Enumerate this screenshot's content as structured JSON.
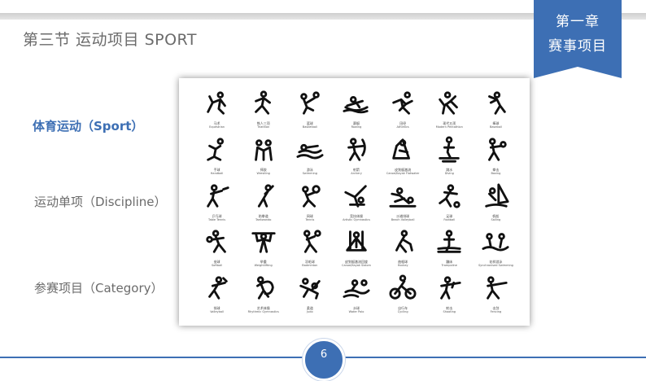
{
  "header": {
    "section_title": "第三节  运动项目 SPORT",
    "chapter_line1": "第一章",
    "chapter_line2": "赛事项目"
  },
  "nav": {
    "sport": "体育运动（Sport）",
    "discipline": "运动单项（Discipline）",
    "category": "参赛项目（Category）"
  },
  "pictograms": [
    {
      "icon": "equestrian-icon",
      "cn": "马术",
      "en": "Equestrian"
    },
    {
      "icon": "triathlon-icon",
      "cn": "铁人三项",
      "en": "Triathlon"
    },
    {
      "icon": "basketball-icon",
      "cn": "篮球",
      "en": "Basketball"
    },
    {
      "icon": "rowing-icon",
      "cn": "赛艇",
      "en": "Rowing"
    },
    {
      "icon": "athletics-icon",
      "cn": "田径",
      "en": "Athletics"
    },
    {
      "icon": "modern-pentathlon-icon",
      "cn": "现代五项",
      "en": "Modern Pentathlon"
    },
    {
      "icon": "baseball-icon",
      "cn": "棒球",
      "en": "Baseball"
    },
    {
      "icon": "handball-icon",
      "cn": "手球",
      "en": "Handball"
    },
    {
      "icon": "wrestling-icon",
      "cn": "摔跤",
      "en": "Wrestling"
    },
    {
      "icon": "swimming-icon",
      "cn": "游泳",
      "en": "Swimming"
    },
    {
      "icon": "archery-icon",
      "cn": "射箭",
      "en": "Archery"
    },
    {
      "icon": "canoe-slalom-icon",
      "cn": "皮划艇激流",
      "en": "Canoe/Kayak Flatwater"
    },
    {
      "icon": "diving-icon",
      "cn": "跳水",
      "en": "Diving"
    },
    {
      "icon": "boxing-icon",
      "cn": "拳击",
      "en": "Boxing"
    },
    {
      "icon": "table-tennis-icon",
      "cn": "乒乓球",
      "en": "Table Tennis"
    },
    {
      "icon": "taekwondo-icon",
      "cn": "跆拳道",
      "en": "Taekwondo"
    },
    {
      "icon": "tennis-icon",
      "cn": "网球",
      "en": "Tennis"
    },
    {
      "icon": "gymnastics-icon",
      "cn": "竞技体操",
      "en": "Artistic Gymnastics"
    },
    {
      "icon": "beach-volleyball-icon",
      "cn": "沙滩排球",
      "en": "Beach Volleyball"
    },
    {
      "icon": "football-icon",
      "cn": "足球",
      "en": "Football"
    },
    {
      "icon": "sailing-icon",
      "cn": "帆船",
      "en": "Sailing"
    },
    {
      "icon": "softball-icon",
      "cn": "垒球",
      "en": "Softball"
    },
    {
      "icon": "weightlifting-icon",
      "cn": "举重",
      "en": "Weightlifting"
    },
    {
      "icon": "badminton-icon",
      "cn": "羽毛球",
      "en": "Badminton"
    },
    {
      "icon": "canoe-kayak-slalom-icon",
      "cn": "皮划艇激流回旋",
      "en": "Canoe/Kayak Slalom"
    },
    {
      "icon": "hockey-icon",
      "cn": "曲棍球",
      "en": "Hockey"
    },
    {
      "icon": "trampoline-icon",
      "cn": "蹦床",
      "en": "Trampoline"
    },
    {
      "icon": "synchronised-swimming-icon",
      "cn": "花样游泳",
      "en": "Synchronised Swimming"
    },
    {
      "icon": "volleyball-icon",
      "cn": "排球",
      "en": "Volleyball"
    },
    {
      "icon": "rhythmic-gymnastics-icon",
      "cn": "艺术体操",
      "en": "Rhythmic Gymnastics"
    },
    {
      "icon": "judo-icon",
      "cn": "柔道",
      "en": "Judo"
    },
    {
      "icon": "water-polo-icon",
      "cn": "水球",
      "en": "Water Polo"
    },
    {
      "icon": "cycling-icon",
      "cn": "自行车",
      "en": "Cycling"
    },
    {
      "icon": "shooting-icon",
      "cn": "射击",
      "en": "Shooting"
    },
    {
      "icon": "fencing-icon",
      "cn": "击剑",
      "en": "Fencing"
    }
  ],
  "footer": {
    "page_number": "6"
  },
  "colors": {
    "accent": "#3d6fb4",
    "text_gray": "#6b6b6b"
  }
}
